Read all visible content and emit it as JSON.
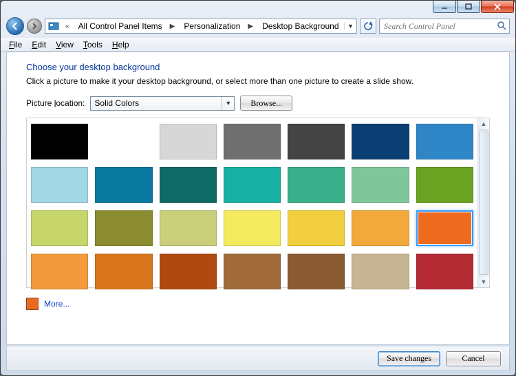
{
  "window_buttons": {
    "min": "Minimize",
    "max": "Maximize",
    "close": "Close"
  },
  "breadcrumb": {
    "overflow": "«",
    "items": [
      "All Control Panel Items",
      "Personalization",
      "Desktop Background"
    ]
  },
  "search": {
    "placeholder": "Search Control Panel"
  },
  "menubar": [
    "File",
    "Edit",
    "View",
    "Tools",
    "Help"
  ],
  "page": {
    "title": "Choose your desktop background",
    "subtitle": "Click a picture to make it your desktop background, or select more than one picture to create a slide show.",
    "picture_location_label": "Picture location:",
    "picture_location_value": "Solid Colors",
    "browse_label": "Browse...",
    "more_label": "More...",
    "more_swatch_color": "#e86a1f"
  },
  "colors": [
    {
      "hex": "#000000"
    },
    {
      "hex": "#ffffff",
      "empty": true
    },
    {
      "hex": "#d7d7d7"
    },
    {
      "hex": "#6f6f6f"
    },
    {
      "hex": "#444444"
    },
    {
      "hex": "#0b3e73"
    },
    {
      "hex": "#2f86c6"
    },
    {
      "hex": "#a2d7e6"
    },
    {
      "hex": "#0a7aa0"
    },
    {
      "hex": "#106a66"
    },
    {
      "hex": "#17b0a2"
    },
    {
      "hex": "#3ab08a"
    },
    {
      "hex": "#7fc79b"
    },
    {
      "hex": "#6aa321"
    },
    {
      "hex": "#c7d66a"
    },
    {
      "hex": "#8a8c2f"
    },
    {
      "hex": "#c9cf7a"
    },
    {
      "hex": "#f4ea5f"
    },
    {
      "hex": "#f2cf3e"
    },
    {
      "hex": "#f2a93a"
    },
    {
      "hex": "#ef6b1f",
      "selected": true
    },
    {
      "hex": "#f29a3c"
    },
    {
      "hex": "#d9761e"
    },
    {
      "hex": "#b0490f"
    },
    {
      "hex": "#a06a3a"
    },
    {
      "hex": "#8a5a33"
    },
    {
      "hex": "#c5b592"
    },
    {
      "hex": "#b32a33"
    }
  ],
  "footer": {
    "save": "Save changes",
    "cancel": "Cancel"
  }
}
